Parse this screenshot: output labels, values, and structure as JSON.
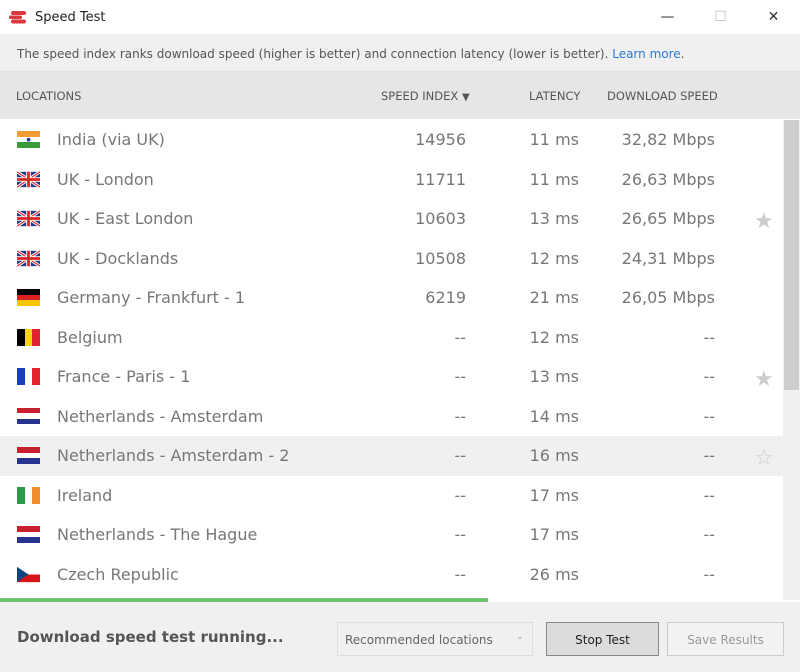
{
  "window": {
    "title": "Speed Test",
    "minimize": "—",
    "maximize": "☐",
    "close": "✕"
  },
  "info": {
    "text": "The speed index ranks download speed (higher is better) and connection latency (lower is better). ",
    "link": "Learn more",
    "after": "."
  },
  "columns": {
    "locations": "LOCATIONS",
    "speed_index": "SPEED INDEX",
    "sort": "▼",
    "latency": "LATENCY",
    "download": "DOWNLOAD SPEED"
  },
  "rows": [
    {
      "flag": "in",
      "name": "India (via UK)",
      "index": "14956",
      "latency": "11 ms",
      "speed": "32,82 Mbps",
      "star": ""
    },
    {
      "flag": "uk",
      "name": "UK - London",
      "index": "11711",
      "latency": "11 ms",
      "speed": "26,63 Mbps",
      "star": ""
    },
    {
      "flag": "uk",
      "name": "UK - East London",
      "index": "10603",
      "latency": "13 ms",
      "speed": "26,65 Mbps",
      "star": "★"
    },
    {
      "flag": "uk",
      "name": "UK - Docklands",
      "index": "10508",
      "latency": "12 ms",
      "speed": "24,31 Mbps",
      "star": ""
    },
    {
      "flag": "de",
      "name": "Germany - Frankfurt - 1",
      "index": "6219",
      "latency": "21 ms",
      "speed": "26,05 Mbps",
      "star": ""
    },
    {
      "flag": "be",
      "name": "Belgium",
      "index": "--",
      "latency": "12 ms",
      "speed": "--",
      "star": ""
    },
    {
      "flag": "fr",
      "name": "France - Paris - 1",
      "index": "--",
      "latency": "13 ms",
      "speed": "--",
      "star": "★"
    },
    {
      "flag": "nl",
      "name": "Netherlands - Amsterdam",
      "index": "--",
      "latency": "14 ms",
      "speed": "--",
      "star": ""
    },
    {
      "flag": "nl",
      "name": "Netherlands - Amsterdam - 2",
      "index": "--",
      "latency": "16 ms",
      "speed": "--",
      "star": "☆"
    },
    {
      "flag": "ie",
      "name": "Ireland",
      "index": "--",
      "latency": "17 ms",
      "speed": "--",
      "star": ""
    },
    {
      "flag": "nl",
      "name": "Netherlands - The Hague",
      "index": "--",
      "latency": "17 ms",
      "speed": "--",
      "star": ""
    },
    {
      "flag": "cz",
      "name": "Czech Republic",
      "index": "--",
      "latency": "26 ms",
      "speed": "--",
      "star": ""
    }
  ],
  "progress_percent": 61,
  "footer": {
    "status": "Download speed test running...",
    "select": "Recommended locations",
    "stop": "Stop Test",
    "save": "Save Results"
  }
}
